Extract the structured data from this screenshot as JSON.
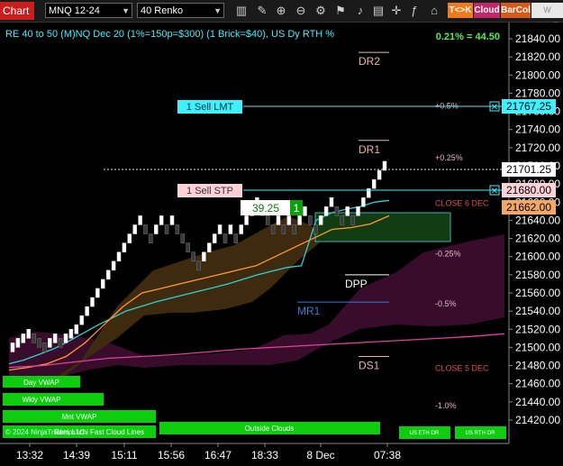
{
  "toolbar": {
    "chart_label": "Chart",
    "instrument": "MNQ 12-24",
    "bar_type": "40 Renko",
    "icons": [
      "bars-icon",
      "draw-icon",
      "zoom-in-icon",
      "zoom-out-icon",
      "properties-icon",
      "strategy-icon",
      "alert-icon",
      "template-icon",
      "crosshair-icon",
      "indicator-icon",
      "lock-icon"
    ],
    "tk_label": "T<>K",
    "cloud_label": "Cloud",
    "barcol_label": "BarCol",
    "ww_label": "W WAVE"
  },
  "header": {
    "title": "RE 40 to 50 (M)NQ Dec 20 (1%=150p=$300) (1 Brick=$40), US Dy RTH %",
    "change": "0.21% = 44.50"
  },
  "orders": {
    "sell_lmt": {
      "label": "1 Sell LMT",
      "price": "21767.25"
    },
    "sell_stp": {
      "label": "1 Sell STP",
      "price": "21680.00"
    },
    "position_price": "39.25",
    "position_qty": "1"
  },
  "price_tags": {
    "last": "21701.25",
    "entry": "21662.00"
  },
  "levels": [
    {
      "label": "DR2",
      "value": 21825,
      "color": "#e8b4b8"
    },
    {
      "label": "DR1",
      "value": 21728,
      "color": "#e8b4b8"
    },
    {
      "label": "DPP",
      "value": 21580,
      "color": "#ffffff"
    },
    {
      "label": "MR1",
      "value": 21550,
      "color": "#3a7bd5"
    },
    {
      "label": "DS1",
      "value": 21490,
      "color": "#e8b4b8"
    }
  ],
  "pct_labels": [
    {
      "label": "+0.5%",
      "value": 21767
    },
    {
      "label": "+0.25%",
      "value": 21710
    },
    {
      "label": "CLOSE 6 DEC",
      "value": 21660
    },
    {
      "label": "-0.25%",
      "value": 21604
    },
    {
      "label": "-0.5%",
      "value": 21549
    },
    {
      "label": "CLOSE 5 DEC",
      "value": 21478
    },
    {
      "label": "-1.0%",
      "value": 21437
    }
  ],
  "bottom_bars": {
    "day_vwap": "Day VWAP",
    "wkly_vwap": "Wkly VWAP",
    "mnt_vwap": "Mnt VWAP",
    "copyright": "© 2024 NinjaTrader, LLC",
    "cloud_lines": "Renko Ichi Fast Cloud Lines",
    "outside_clouds": "Outside Clouds",
    "us_eth_or": "US ETH OR",
    "us_rth_or": "US RTH OR"
  },
  "chart_data": {
    "type": "renko",
    "ylim": [
      21405,
      21855
    ],
    "y_ticks": [
      21840,
      21820,
      21800,
      21780,
      21760,
      21740,
      21720,
      21700,
      21680,
      21660,
      21640,
      21620,
      21600,
      21580,
      21560,
      21540,
      21520,
      21500,
      21480,
      21460,
      21440,
      21420
    ],
    "x_ticks": [
      "13:32",
      "14:39",
      "15:11",
      "15:56",
      "16:47",
      "18:33",
      "8 Dec",
      "07:38"
    ],
    "brick_size": 10,
    "bricks": [
      [
        21495,
        21505,
        "up"
      ],
      [
        21500,
        21510,
        "up"
      ],
      [
        21505,
        21515,
        "up"
      ],
      [
        21510,
        21520,
        "up"
      ],
      [
        21505,
        21515,
        "dn"
      ],
      [
        21500,
        21510,
        "dn"
      ],
      [
        21495,
        21505,
        "dn"
      ],
      [
        21500,
        21510,
        "up"
      ],
      [
        21505,
        21515,
        "up"
      ],
      [
        21500,
        21510,
        "dn"
      ],
      [
        21505,
        21515,
        "up"
      ],
      [
        21510,
        21520,
        "up"
      ],
      [
        21515,
        21525,
        "up"
      ],
      [
        21525,
        21535,
        "up"
      ],
      [
        21535,
        21545,
        "up"
      ],
      [
        21545,
        21555,
        "up"
      ],
      [
        21555,
        21565,
        "up"
      ],
      [
        21565,
        21575,
        "up"
      ],
      [
        21575,
        21585,
        "up"
      ],
      [
        21585,
        21595,
        "up"
      ],
      [
        21595,
        21605,
        "up"
      ],
      [
        21605,
        21615,
        "up"
      ],
      [
        21615,
        21625,
        "up"
      ],
      [
        21625,
        21635,
        "up"
      ],
      [
        21635,
        21645,
        "up"
      ],
      [
        21625,
        21635,
        "dn"
      ],
      [
        21615,
        21625,
        "dn"
      ],
      [
        21625,
        21635,
        "up"
      ],
      [
        21635,
        21645,
        "up"
      ],
      [
        21625,
        21635,
        "dn"
      ],
      [
        21635,
        21645,
        "up"
      ],
      [
        21625,
        21635,
        "dn"
      ],
      [
        21615,
        21625,
        "dn"
      ],
      [
        21605,
        21615,
        "dn"
      ],
      [
        21595,
        21605,
        "dn"
      ],
      [
        21585,
        21595,
        "dn"
      ],
      [
        21595,
        21605,
        "up"
      ],
      [
        21605,
        21615,
        "up"
      ],
      [
        21615,
        21625,
        "up"
      ],
      [
        21625,
        21635,
        "up"
      ],
      [
        21615,
        21625,
        "dn"
      ],
      [
        21625,
        21635,
        "up"
      ],
      [
        21615,
        21625,
        "dn"
      ],
      [
        21625,
        21635,
        "up"
      ],
      [
        21635,
        21645,
        "up"
      ],
      [
        21645,
        21655,
        "up"
      ],
      [
        21655,
        21665,
        "up"
      ],
      [
        21645,
        21655,
        "dn"
      ],
      [
        21635,
        21645,
        "dn"
      ],
      [
        21625,
        21635,
        "dn"
      ],
      [
        21635,
        21645,
        "up"
      ],
      [
        21625,
        21635,
        "dn"
      ],
      [
        21635,
        21645,
        "up"
      ],
      [
        21625,
        21635,
        "dn"
      ],
      [
        21635,
        21645,
        "up"
      ],
      [
        21645,
        21655,
        "up"
      ],
      [
        21635,
        21645,
        "dn"
      ],
      [
        21625,
        21635,
        "dn"
      ],
      [
        21635,
        21645,
        "up"
      ],
      [
        21645,
        21655,
        "up"
      ],
      [
        21655,
        21665,
        "up"
      ],
      [
        21645,
        21655,
        "dn"
      ],
      [
        21635,
        21645,
        "dn"
      ],
      [
        21645,
        21655,
        "up"
      ],
      [
        21635,
        21645,
        "dn"
      ],
      [
        21645,
        21655,
        "up"
      ],
      [
        21655,
        21665,
        "up"
      ],
      [
        21665,
        21675,
        "up"
      ],
      [
        21675,
        21685,
        "up"
      ],
      [
        21685,
        21695,
        "up"
      ],
      [
        21695,
        21705,
        "up"
      ]
    ],
    "series": [
      {
        "name": "Day VWAP",
        "color": "#2fd3d3",
        "values": [
          21482,
          21486,
          21492,
          21498,
          21506,
          21515,
          21524,
          21532,
          21540,
          21545,
          21550,
          21554,
          21558,
          21562,
          21566,
          21570,
          21575,
          21580,
          21584,
          21588,
          21590,
          21640,
          21648,
          21652,
          21655,
          21660,
          21662
        ]
      },
      {
        "name": "Wkly VWAP",
        "color": "#ff9a2e",
        "values": [
          21475,
          21478,
          21482,
          21490,
          21505,
          21525,
          21545,
          21560,
          21565,
          21570,
          21575,
          21580,
          21585,
          21590,
          21600,
          21610,
          21620,
          21630,
          21632,
          21636,
          21645
        ]
      },
      {
        "name": "Mnt VWAP",
        "color": "#e040a0",
        "values": [
          21478,
          21480,
          21484,
          21488,
          21490,
          21492,
          21495,
          21498,
          21500,
          21502,
          21504,
          21506,
          21508,
          21510,
          21512,
          21515
        ]
      }
    ]
  },
  "colors": {
    "up_brick": "#ffffff",
    "down_brick": "#3a3a3a",
    "accent_green": "#00c800",
    "cyan": "#3ff0ff",
    "pink": "#ffd0d8",
    "tag": "#f3a86a"
  }
}
